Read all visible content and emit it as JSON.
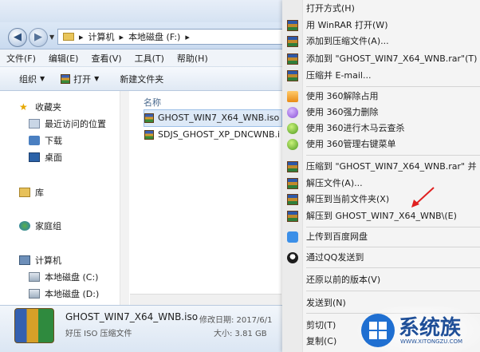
{
  "address": {
    "crumbs": [
      "计算机",
      "本地磁盘 (F:)"
    ]
  },
  "menubar": [
    "文件(F)",
    "编辑(E)",
    "查看(V)",
    "工具(T)",
    "帮助(H)"
  ],
  "toolbar": {
    "organize": "组织",
    "open": "打开",
    "new_folder": "新建文件夹"
  },
  "nav": {
    "favorites": "收藏夹",
    "recent": "最近访问的位置",
    "downloads": "下载",
    "desktop": "桌面",
    "libraries": "库",
    "homegroup": "家庭组",
    "computer": "计算机",
    "drive_c": "本地磁盘 (C:)",
    "drive_d": "本地磁盘 (D:)"
  },
  "files": {
    "column_name": "名称",
    "items": [
      "GHOST_WIN7_X64_WNB.iso",
      "SDJS_GHOST_XP_DNCWNB.i"
    ]
  },
  "details": {
    "filename": "GHOST_WIN7_X64_WNB.iso",
    "modified": "修改日期: 2017/6/1",
    "type": "好压 ISO 压缩文件",
    "size": "大小: 3.81 GB"
  },
  "context_menu": [
    "打开方式(H)",
    "用 WinRAR 打开(W)",
    "添加到压缩文件(A)...",
    "添加到 \"GHOST_WIN7_X64_WNB.rar\"(T)",
    "压缩并 E-mail...",
    "使用 360解除占用",
    "使用 360强力删除",
    "使用 360进行木马云查杀",
    "使用 360管理右键菜单",
    "压缩到 \"GHOST_WIN7_X64_WNB.rar\" 并 E",
    "解压文件(A)...",
    "解压到当前文件夹(X)",
    "解压到 GHOST_WIN7_X64_WNB\\(E)",
    "上传到百度网盘",
    "通过QQ发送到",
    "还原以前的版本(V)",
    "发送到(N)",
    "剪切(T)",
    "复制(C)"
  ],
  "watermark": {
    "brand": "系统族",
    "url": "WWW.XITONGZU.COM"
  }
}
